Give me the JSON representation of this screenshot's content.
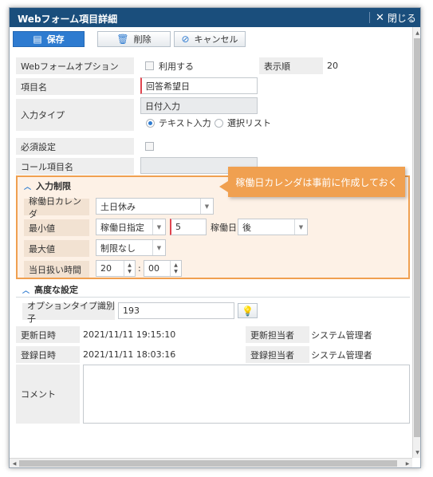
{
  "window": {
    "title": "Webフォーム項目詳細",
    "close_label": "閉じる"
  },
  "toolbar": {
    "save_label": "保存",
    "delete_label": "削除",
    "cancel_label": "キャンセル"
  },
  "form": {
    "webform_option_label": "Webフォームオプション",
    "use_label": "利用する",
    "display_order_label": "表示順",
    "display_order_value": "20",
    "item_name_label": "項目名",
    "item_name_value": "回答希望日",
    "input_type_label": "入力タイプ",
    "input_type_value": "日付入力",
    "radio_text_label": "テキスト入力",
    "radio_list_label": "選択リスト",
    "required_label": "必須設定",
    "call_item_label": "コール項目名"
  },
  "input_limit": {
    "section_label": "入力制限",
    "calendar_label": "稼働日カレンダ",
    "calendar_value": "土日休み",
    "min_label": "最小値",
    "min_type_value": "稼働日指定",
    "min_number_value": "5",
    "min_unit_label": "稼働日",
    "min_direction_value": "後",
    "max_label": "最大値",
    "max_value": "制限なし",
    "sameday_label": "当日扱い時間",
    "hour_value": "20",
    "minute_value": "00",
    "time_separator": ":"
  },
  "tooltip": {
    "text": "稼働日カレンダは事前に作成しておく"
  },
  "advanced": {
    "section_label": "高度な設定",
    "option_type_label": "オプションタイプ識別子",
    "option_type_value": "193"
  },
  "meta": {
    "updated_at_label": "更新日時",
    "updated_at_value": "2021/11/11 19:15:10",
    "updated_by_label": "更新担当者",
    "updated_by_value": "システム管理者",
    "created_at_label": "登録日時",
    "created_at_value": "2021/11/11 18:03:16",
    "created_by_label": "登録担当者",
    "created_by_value": "システム管理者",
    "comment_label": "コメント"
  },
  "colors": {
    "titlebar": "#1a4e7c",
    "primary": "#2e7bd0",
    "highlight": "#f0a050",
    "required": "#e0454f"
  }
}
